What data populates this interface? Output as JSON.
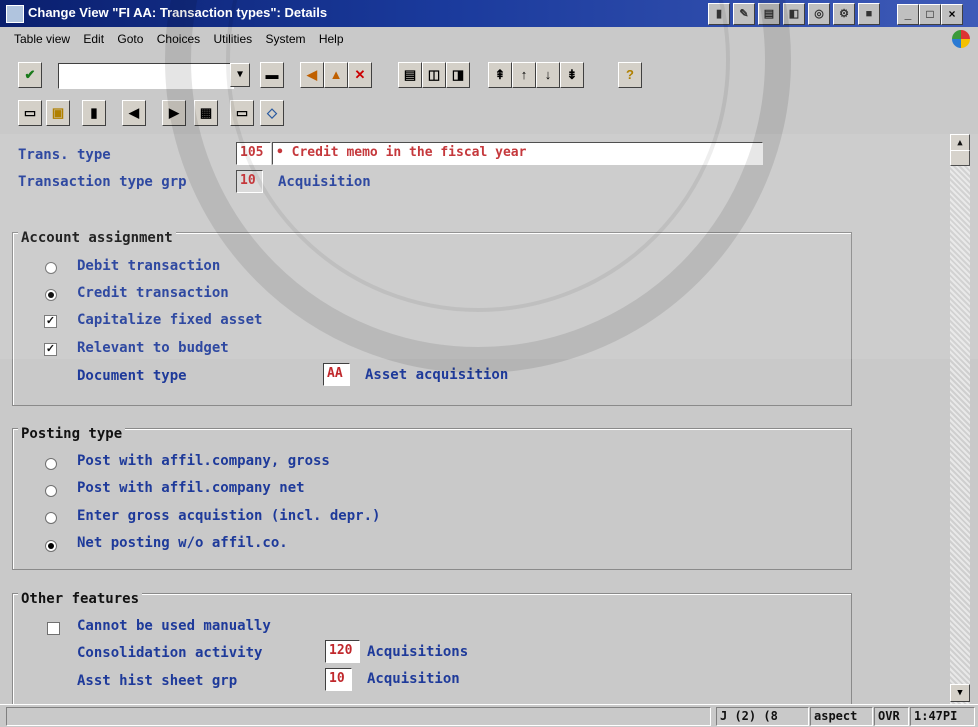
{
  "window": {
    "title": "Change View \"FI AA: Transaction types\": Details",
    "controls": {
      "minimize": "_",
      "maximize": "□",
      "close": "×"
    }
  },
  "menu": [
    "Table view",
    "Edit",
    "Goto",
    "Choices",
    "Utilities",
    "System",
    "Help"
  ],
  "toolbar": {
    "command_value": "",
    "icons": [
      "enter-icon",
      "save-icon",
      "back-icon",
      "exit-icon",
      "cancel-icon",
      "print-icon",
      "find-icon",
      "find-next-icon",
      "first-page-icon",
      "prev-page-icon",
      "next-page-icon",
      "last-page-icon",
      "help-icon"
    ]
  },
  "app_toolbar": {
    "icons": [
      "new-entries-icon",
      "copy-icon",
      "delete-icon",
      "prev-entry-icon",
      "next-entry-icon",
      "select-all-icon",
      "print-icon",
      "change-icon"
    ]
  },
  "header": {
    "trans_type_label": "Trans. type",
    "trans_type_value": "105",
    "trans_type_text": "• Credit memo in the fiscal year",
    "grp_label": "Transaction type grp",
    "grp_value": "10",
    "grp_text": "Acquisition"
  },
  "account_assignment": {
    "title": "Account assignment",
    "debit_label": "Debit transaction",
    "debit_selected": false,
    "credit_label": "Credit transaction",
    "credit_selected": true,
    "capitalize_label": "Capitalize fixed asset",
    "capitalize_checked": true,
    "budget_label": "Relevant to budget",
    "budget_checked": true,
    "doctype_label": "Document type",
    "doctype_value": "AA",
    "doctype_text": "Asset acquisition"
  },
  "posting_type": {
    "title": "Posting type",
    "options": [
      {
        "label": "Post with affil.company, gross",
        "selected": false
      },
      {
        "label": "Post with affil.company net",
        "selected": false
      },
      {
        "label": "Enter gross acquistion (incl. depr.)",
        "selected": false
      },
      {
        "label": "Net posting w/o affil.co.",
        "selected": true
      }
    ]
  },
  "other_features": {
    "title": "Other features",
    "manual_label": "Cannot be used manually",
    "manual_checked": false,
    "consol_label": "Consolidation activity",
    "consol_value": "120",
    "consol_text": "Acquisitions",
    "ahs_label": "Asst hist sheet grp",
    "ahs_value": "10",
    "ahs_text": "Acquisition"
  },
  "status": {
    "session": "J (2) (8",
    "server": "aspect",
    "mode": "OVR",
    "time": "1:47PI"
  },
  "colors": {
    "titlebar": "#0a1f6e",
    "label_blue": "#1e3a9a",
    "value_red": "#c0282c",
    "background": "#c9c9c9"
  }
}
